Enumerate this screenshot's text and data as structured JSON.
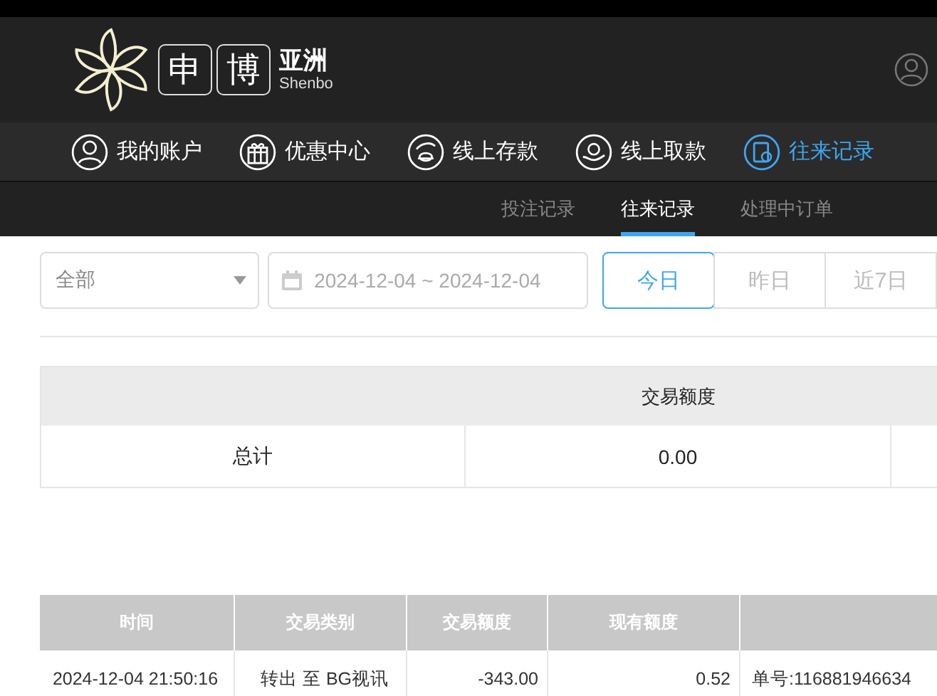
{
  "logo": {
    "chars": [
      "申",
      "博"
    ],
    "region": "亚洲",
    "latin": "Shenbo"
  },
  "nav": [
    {
      "label": "我的账户",
      "kind": "user",
      "selected": false
    },
    {
      "label": "优惠中心",
      "kind": "gift",
      "selected": false
    },
    {
      "label": "线上存款",
      "kind": "deposit",
      "selected": false
    },
    {
      "label": "线上取款",
      "kind": "withdraw",
      "selected": false
    },
    {
      "label": "往来记录",
      "kind": "record",
      "selected": true
    }
  ],
  "subtabs": [
    {
      "label": "投注记录",
      "selected": false
    },
    {
      "label": "往来记录",
      "selected": true
    },
    {
      "label": "处理中订单",
      "selected": false
    }
  ],
  "filter": {
    "type_select": "全部",
    "date_range": "2024-12-04 ~ 2024-12-04",
    "ranges": [
      {
        "label": "今日",
        "selected": true
      },
      {
        "label": "昨日",
        "selected": false
      },
      {
        "label": "近7日",
        "selected": false
      }
    ]
  },
  "summary": {
    "header": "交易额度",
    "total_label": "总计",
    "total_value": "0.00"
  },
  "table": {
    "columns": [
      "时间",
      "交易类别",
      "交易额度",
      "现有额度"
    ],
    "rows": [
      [
        "2024-12-04 21:50:16",
        "转出 至 BG视讯",
        "-343.00",
        "0.52",
        "单号:116881946634"
      ]
    ]
  }
}
